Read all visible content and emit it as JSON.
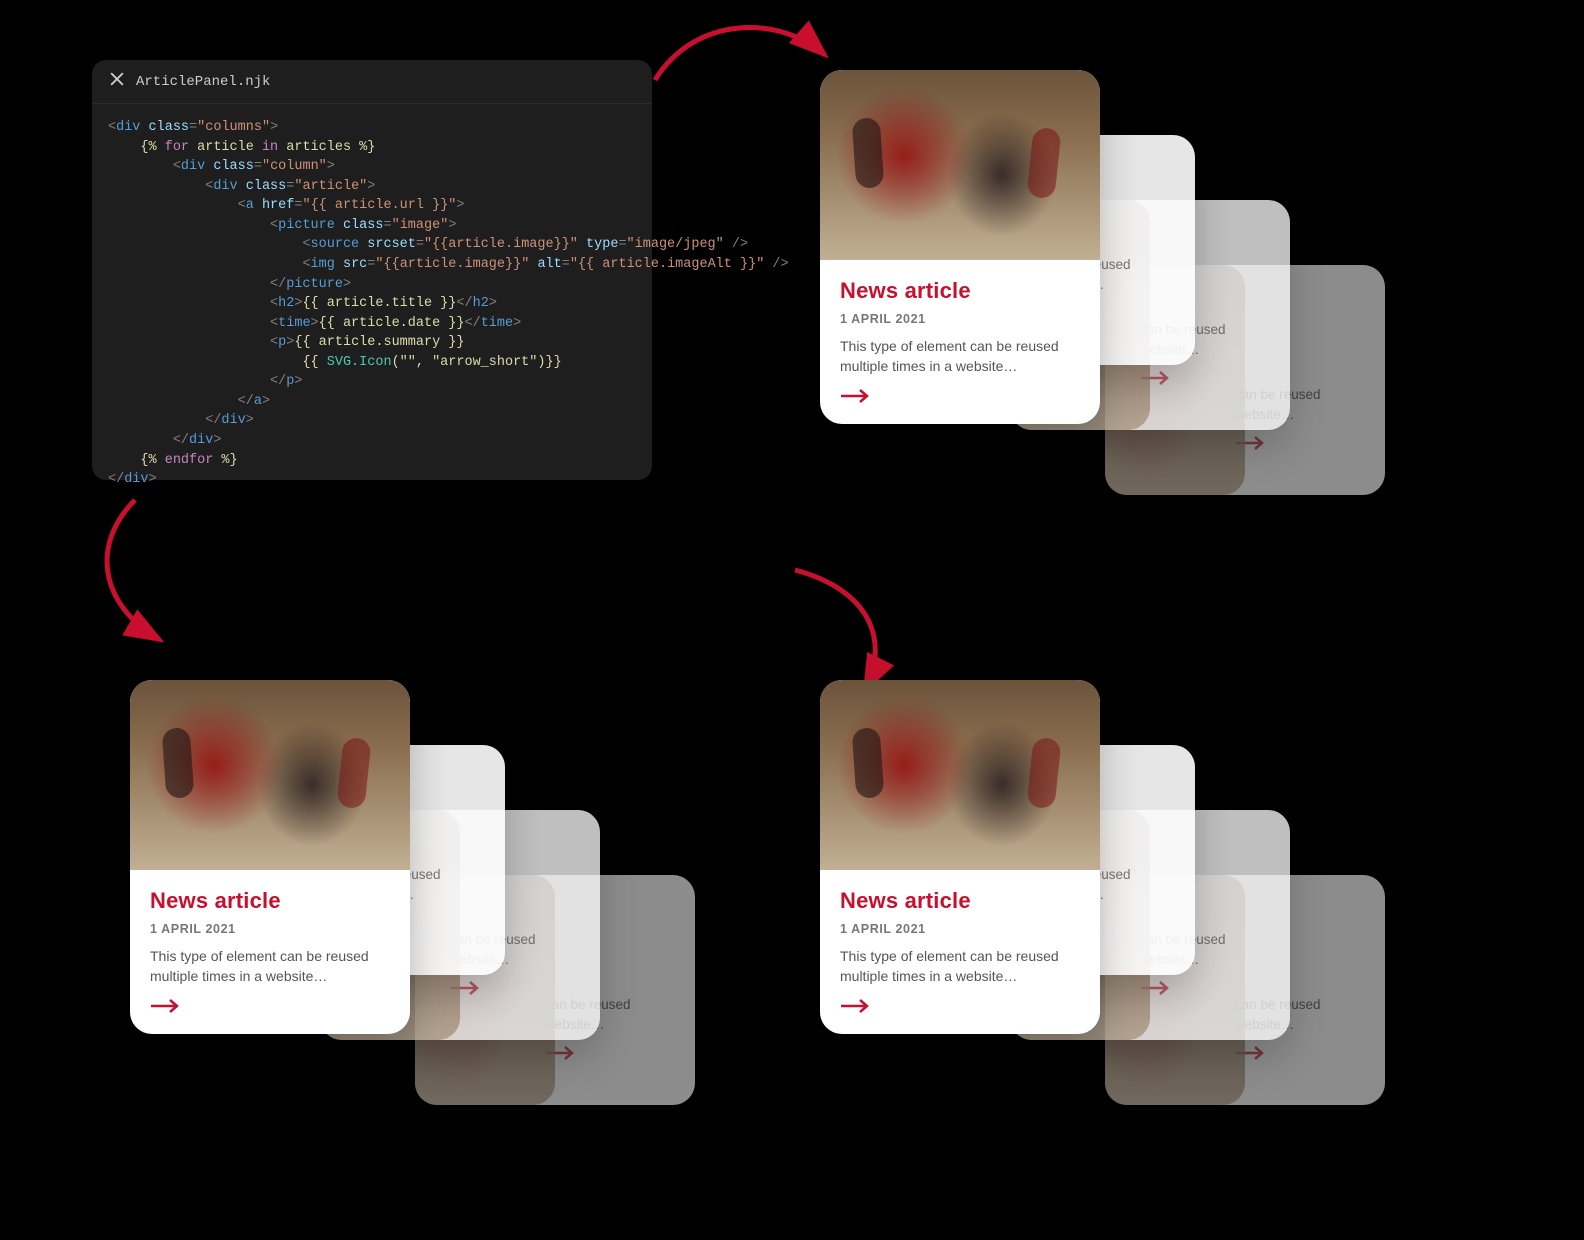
{
  "editor": {
    "filename": "ArticlePanel.njk",
    "code_lines": [
      {
        "indent": 0,
        "segments": [
          {
            "c": "t-tag",
            "t": "<"
          },
          {
            "c": "t-name",
            "t": "div"
          },
          {
            "c": "t-tag",
            "t": " "
          },
          {
            "c": "t-attr",
            "t": "class"
          },
          {
            "c": "t-tag",
            "t": "="
          },
          {
            "c": "t-str",
            "t": "\"columns\""
          },
          {
            "c": "t-tag",
            "t": ">"
          }
        ]
      },
      {
        "indent": 1,
        "segments": [
          {
            "c": "t-tmpl",
            "t": "{% "
          },
          {
            "c": "t-kw",
            "t": "for"
          },
          {
            "c": "t-tmpl",
            "t": " article "
          },
          {
            "c": "t-kw",
            "t": "in"
          },
          {
            "c": "t-tmpl",
            "t": " articles %}"
          }
        ]
      },
      {
        "indent": 2,
        "segments": [
          {
            "c": "t-tag",
            "t": "<"
          },
          {
            "c": "t-name",
            "t": "div"
          },
          {
            "c": "t-tag",
            "t": " "
          },
          {
            "c": "t-attr",
            "t": "class"
          },
          {
            "c": "t-tag",
            "t": "="
          },
          {
            "c": "t-str",
            "t": "\"column\""
          },
          {
            "c": "t-tag",
            "t": ">"
          }
        ]
      },
      {
        "indent": 3,
        "segments": [
          {
            "c": "t-tag",
            "t": "<"
          },
          {
            "c": "t-name",
            "t": "div"
          },
          {
            "c": "t-tag",
            "t": " "
          },
          {
            "c": "t-attr",
            "t": "class"
          },
          {
            "c": "t-tag",
            "t": "="
          },
          {
            "c": "t-str",
            "t": "\"article\""
          },
          {
            "c": "t-tag",
            "t": ">"
          }
        ]
      },
      {
        "indent": 4,
        "segments": [
          {
            "c": "t-tag",
            "t": "<"
          },
          {
            "c": "t-name",
            "t": "a"
          },
          {
            "c": "t-tag",
            "t": " "
          },
          {
            "c": "t-attr",
            "t": "href"
          },
          {
            "c": "t-tag",
            "t": "="
          },
          {
            "c": "t-str",
            "t": "\"{{ article.url }}\""
          },
          {
            "c": "t-tag",
            "t": ">"
          }
        ]
      },
      {
        "indent": 5,
        "segments": [
          {
            "c": "t-tag",
            "t": "<"
          },
          {
            "c": "t-name",
            "t": "picture"
          },
          {
            "c": "t-tag",
            "t": " "
          },
          {
            "c": "t-attr",
            "t": "class"
          },
          {
            "c": "t-tag",
            "t": "="
          },
          {
            "c": "t-str",
            "t": "\"image\""
          },
          {
            "c": "t-tag",
            "t": ">"
          }
        ]
      },
      {
        "indent": 6,
        "segments": [
          {
            "c": "t-tag",
            "t": "<"
          },
          {
            "c": "t-name",
            "t": "source"
          },
          {
            "c": "t-tag",
            "t": " "
          },
          {
            "c": "t-attr",
            "t": "srcset"
          },
          {
            "c": "t-tag",
            "t": "="
          },
          {
            "c": "t-str",
            "t": "\"{{article.image}}\""
          },
          {
            "c": "t-tag",
            "t": " "
          },
          {
            "c": "t-attr",
            "t": "type"
          },
          {
            "c": "t-tag",
            "t": "="
          },
          {
            "c": "t-str",
            "t": "\"image/jpeg\""
          },
          {
            "c": "t-tag",
            "t": " />"
          }
        ]
      },
      {
        "indent": 6,
        "segments": [
          {
            "c": "t-tag",
            "t": "<"
          },
          {
            "c": "t-name",
            "t": "img"
          },
          {
            "c": "t-tag",
            "t": " "
          },
          {
            "c": "t-attr",
            "t": "src"
          },
          {
            "c": "t-tag",
            "t": "="
          },
          {
            "c": "t-str",
            "t": "\"{{article.image}}\""
          },
          {
            "c": "t-tag",
            "t": " "
          },
          {
            "c": "t-attr",
            "t": "alt"
          },
          {
            "c": "t-tag",
            "t": "="
          },
          {
            "c": "t-str",
            "t": "\"{{ article.imageAlt }}\""
          },
          {
            "c": "t-tag",
            "t": " />"
          }
        ]
      },
      {
        "indent": 5,
        "segments": [
          {
            "c": "t-tag",
            "t": "</"
          },
          {
            "c": "t-name",
            "t": "picture"
          },
          {
            "c": "t-tag",
            "t": ">"
          }
        ]
      },
      {
        "indent": 5,
        "segments": [
          {
            "c": "t-tag",
            "t": "<"
          },
          {
            "c": "t-name",
            "t": "h2"
          },
          {
            "c": "t-tag",
            "t": ">"
          },
          {
            "c": "t-tmpl",
            "t": "{{ article.title }}"
          },
          {
            "c": "t-tag",
            "t": "</"
          },
          {
            "c": "t-name",
            "t": "h2"
          },
          {
            "c": "t-tag",
            "t": ">"
          }
        ]
      },
      {
        "indent": 5,
        "segments": [
          {
            "c": "t-tag",
            "t": "<"
          },
          {
            "c": "t-name",
            "t": "time"
          },
          {
            "c": "t-tag",
            "t": ">"
          },
          {
            "c": "t-tmpl",
            "t": "{{ article.date }}"
          },
          {
            "c": "t-tag",
            "t": "</"
          },
          {
            "c": "t-name",
            "t": "time"
          },
          {
            "c": "t-tag",
            "t": ">"
          }
        ]
      },
      {
        "indent": 5,
        "segments": [
          {
            "c": "t-tag",
            "t": "<"
          },
          {
            "c": "t-name",
            "t": "p"
          },
          {
            "c": "t-tag",
            "t": ">"
          },
          {
            "c": "t-tmpl",
            "t": "{{ article.summary }}"
          }
        ]
      },
      {
        "indent": 6,
        "segments": [
          {
            "c": "t-tmpl",
            "t": "{{ "
          },
          {
            "c": "t-var",
            "t": "SVG.Icon"
          },
          {
            "c": "t-tmpl",
            "t": "(\"\", \"arrow_short\")}}"
          }
        ]
      },
      {
        "indent": 5,
        "segments": [
          {
            "c": "t-tag",
            "t": "</"
          },
          {
            "c": "t-name",
            "t": "p"
          },
          {
            "c": "t-tag",
            "t": ">"
          }
        ]
      },
      {
        "indent": 4,
        "segments": [
          {
            "c": "t-tag",
            "t": "</"
          },
          {
            "c": "t-name",
            "t": "a"
          },
          {
            "c": "t-tag",
            "t": ">"
          }
        ]
      },
      {
        "indent": 3,
        "segments": [
          {
            "c": "t-tag",
            "t": "</"
          },
          {
            "c": "t-name",
            "t": "div"
          },
          {
            "c": "t-tag",
            "t": ">"
          }
        ]
      },
      {
        "indent": 2,
        "segments": [
          {
            "c": "t-tag",
            "t": "</"
          },
          {
            "c": "t-name",
            "t": "div"
          },
          {
            "c": "t-tag",
            "t": ">"
          }
        ]
      },
      {
        "indent": 1,
        "segments": [
          {
            "c": "t-tmpl",
            "t": "{% "
          },
          {
            "c": "t-kw",
            "t": "endfor"
          },
          {
            "c": "t-tmpl",
            "t": " %}"
          }
        ]
      },
      {
        "indent": 0,
        "segments": [
          {
            "c": "t-tag",
            "t": "</"
          },
          {
            "c": "t-name",
            "t": "div"
          },
          {
            "c": "t-tag",
            "t": ">"
          }
        ]
      }
    ]
  },
  "card": {
    "title": "News article",
    "date": "1 APRIL 2021",
    "summary": "This type of element can be reused multiple times in a website…",
    "under_summary_tail": "can be reused website…"
  },
  "colors": {
    "accent": "#c8102e"
  }
}
